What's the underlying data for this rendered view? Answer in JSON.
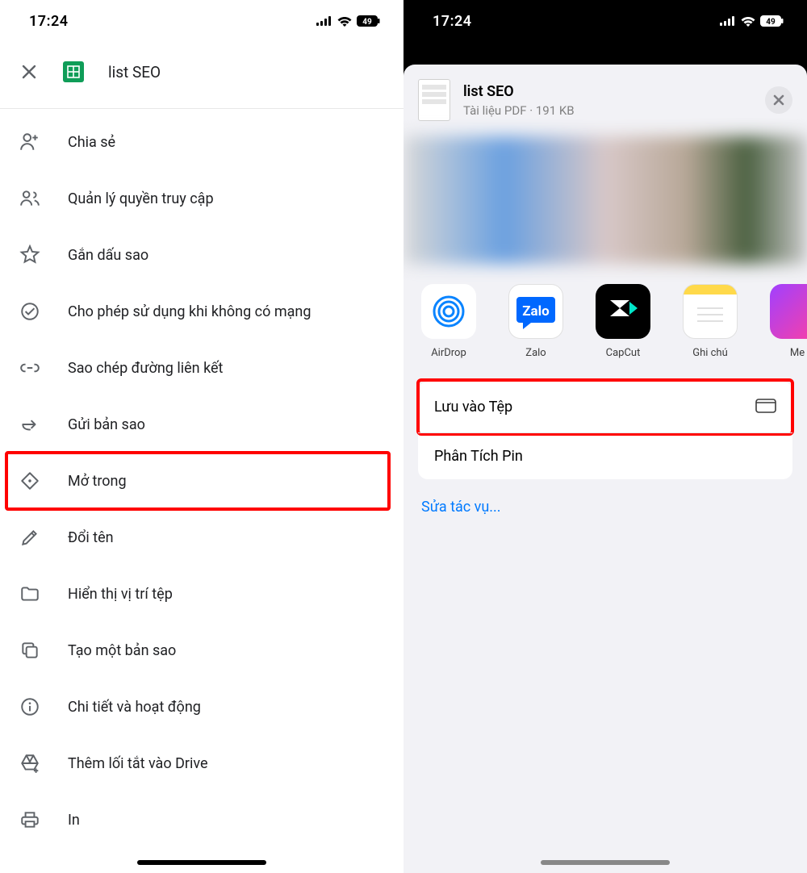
{
  "status": {
    "time": "17:24",
    "battery": "49"
  },
  "left": {
    "doc_title": "list SEO",
    "menu": [
      {
        "icon": "person-add",
        "label": "Chia sẻ"
      },
      {
        "icon": "people",
        "label": "Quản lý quyền truy cập"
      },
      {
        "icon": "star",
        "label": "Gắn dấu sao"
      },
      {
        "icon": "offline",
        "label": "Cho phép sử dụng khi không có mạng"
      },
      {
        "icon": "link",
        "label": "Sao chép đường liên kết"
      },
      {
        "icon": "forward",
        "label": "Gửi bản sao"
      },
      {
        "icon": "open-in",
        "label": "Mở trong",
        "highlight": true
      },
      {
        "icon": "pencil",
        "label": "Đổi tên"
      },
      {
        "icon": "folder",
        "label": "Hiển thị vị trí tệp"
      },
      {
        "icon": "copy",
        "label": "Tạo một bản sao"
      },
      {
        "icon": "info",
        "label": "Chi tiết và hoạt động"
      },
      {
        "icon": "drive-shortcut",
        "label": "Thêm lối tắt vào Drive"
      },
      {
        "icon": "print",
        "label": "In"
      }
    ]
  },
  "right": {
    "title": "list SEO",
    "subtitle": "Tài liệu PDF · 191 KB",
    "apps": [
      {
        "id": "airdrop",
        "label": "AirDrop"
      },
      {
        "id": "zalo",
        "label": "Zalo"
      },
      {
        "id": "capcut",
        "label": "CapCut"
      },
      {
        "id": "notes",
        "label": "Ghi chú"
      },
      {
        "id": "more",
        "label": "Me"
      }
    ],
    "actions": [
      {
        "label": "Lưu vào Tệp",
        "icon": "folder",
        "highlight": true
      },
      {
        "label": "Phân Tích Pin",
        "icon": ""
      }
    ],
    "edit_label": "Sửa tác vụ..."
  }
}
